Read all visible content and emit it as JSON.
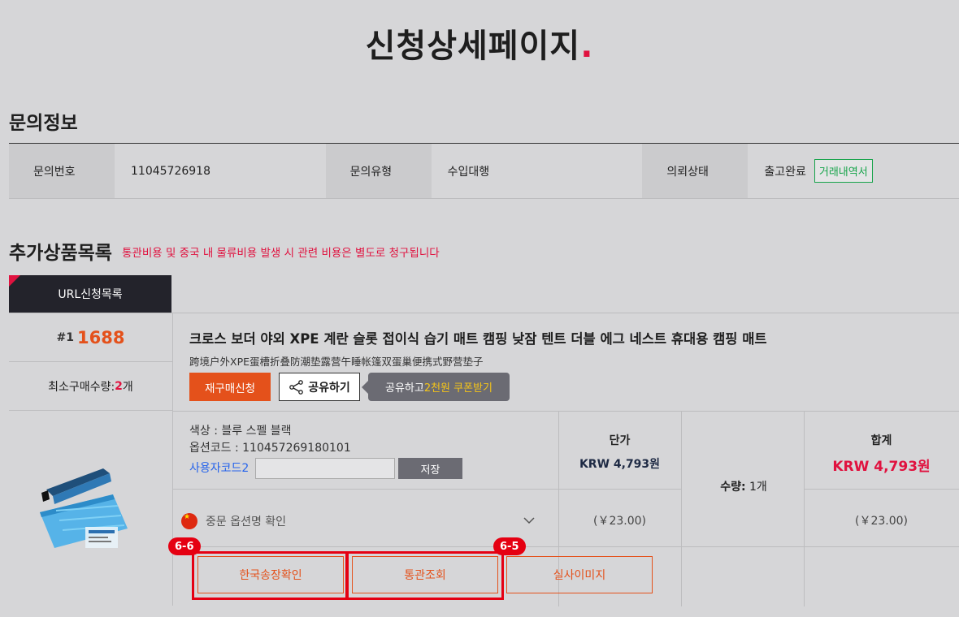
{
  "page": {
    "title": "신청상세페이지",
    "title_dot": "."
  },
  "inquiry": {
    "section_title": "문의정보",
    "fields": [
      {
        "label": "문의번호",
        "value": "11045726918"
      },
      {
        "label": "문의유형",
        "value": "수입대행"
      },
      {
        "label": "의뢰상태",
        "value": "출고완료"
      }
    ],
    "status_button": "거래내역서"
  },
  "extra": {
    "section_title": "추가상품목록",
    "notice": "통관비용 및 중국 내 물류비용 발생 시 관련 비용은 별도로 청구됩니다",
    "tab_label": "URL신청목록"
  },
  "product": {
    "index": "#1",
    "source": "1688",
    "min_order_label": "최소구매수량:",
    "min_order_value": "2",
    "min_order_unit": "개",
    "name": "크로스 보더 야외 XPE 계란 슬롯 접이식 습기 매트 캠핑 낮잠 텐트 더블 에그 네스트 휴대용 캠핑 매트",
    "original_name": "跨境户外XPE蛋槽折叠防潮垫露营午睡帐篷双蛋巢便携式野营垫子",
    "rebuy_button": "재구매신청",
    "share_button": "공유하기",
    "tooltip_prefix": "공유하고 ",
    "tooltip_highlight": "2천원 쿠폰받기",
    "option_color": "색상 : 블루 스펠 블랙",
    "option_code": "옵션코드 : 110457269180101",
    "user_code_label": "사용자코드2",
    "save_button": "저장",
    "cn_option_label": "중문 옵션명 확인",
    "unit_price_label": "단가",
    "unit_price": "KRW 4,793원",
    "unit_price_cny": "(￥23.00)",
    "quantity_label": "수량:",
    "quantity_value": " 1개",
    "total_label": "합계",
    "total_price": "KRW 4,793원",
    "total_cny": "(￥23.00)",
    "actions": [
      "한국송장확인",
      "통관조회",
      "실사이미지"
    ]
  },
  "annotations": {
    "marker_1": "6-6",
    "marker_2": "6-5"
  },
  "colors": {
    "accent_red": "#e0123f",
    "orange": "#e4511b",
    "highlight_red": "#e50012",
    "green": "#16a34a"
  }
}
